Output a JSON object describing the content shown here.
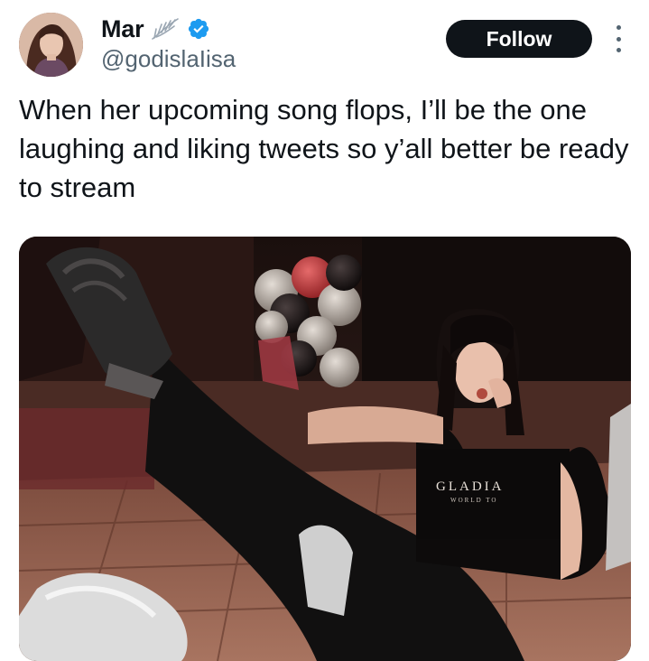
{
  "author": {
    "display_name": "Mar",
    "name_emoji": "wing-icon",
    "verified": true,
    "verified_color": "#1d9bf0",
    "handle": "@godislaIisa"
  },
  "actions": {
    "follow_label": "Follow",
    "more_icon": "more-vertical-icon"
  },
  "tweet": {
    "text": "When her upcoming song flops, I’ll be the one laughing and liking tweets so y’all better be ready to stream"
  },
  "media": {
    "shirt_text": "GLADIA",
    "shirt_subtext": "WORLD TO"
  },
  "colors": {
    "text": "#0f1419",
    "secondary": "#536471",
    "follow_bg": "#0f1419",
    "follow_text": "#ffffff"
  }
}
